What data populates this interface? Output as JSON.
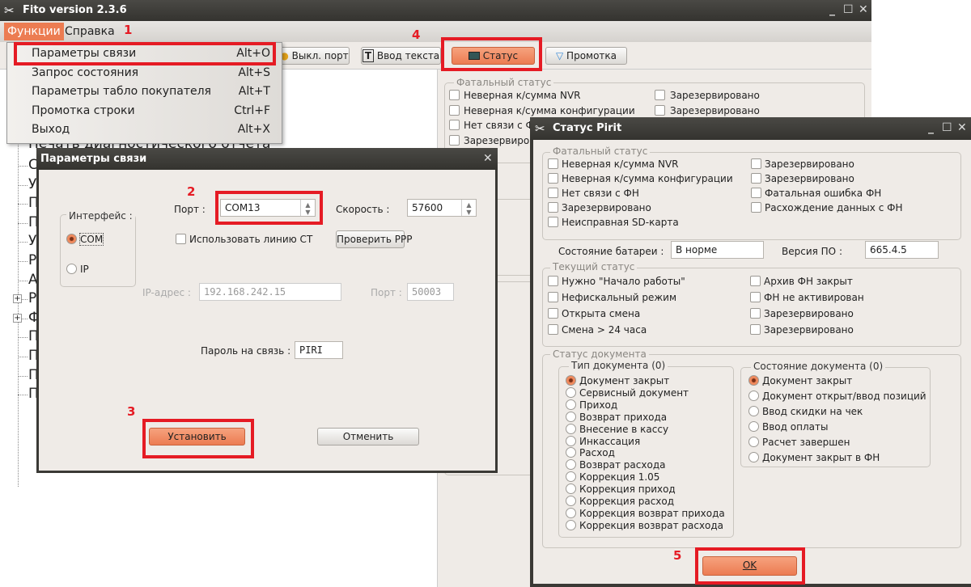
{
  "main_window": {
    "title": "Fito version 2.3.6",
    "menu": [
      "Функции",
      "Справка"
    ],
    "toolbar": {
      "port_off": "Выкл. порт",
      "text_input": "Ввод текста",
      "status": "Статус",
      "scroll": "Промотка"
    },
    "tree": {
      "first_item": "Печать диагностического отчета",
      "partial_items": [
        "С",
        "У",
        "П",
        "П",
        "У",
        "Р",
        "А",
        "Р",
        "Ф",
        "П",
        "П",
        "П",
        "П"
      ],
      "expandable": [
        7,
        8
      ]
    }
  },
  "functions_menu": [
    {
      "label": "Параметры связи",
      "shortcut": "Alt+O"
    },
    {
      "label": "Запрос состояния",
      "shortcut": "Alt+S"
    },
    {
      "label": "Параметры табло покупателя",
      "shortcut": "Alt+T"
    },
    {
      "label": "Промотка строки",
      "shortcut": "Ctrl+F"
    },
    {
      "label": "Выход",
      "shortcut": "Alt+X"
    }
  ],
  "annotations": [
    "1",
    "2",
    "3",
    "4",
    "5"
  ],
  "connection_dialog": {
    "title": "Параметры связи",
    "interface_label": "Интерфейс :",
    "interface_options": [
      "COM",
      "IP"
    ],
    "interface_selected": "COM",
    "port_label": "Порт :",
    "port_value": "COM13",
    "speed_label": "Скорость :",
    "speed_value": "57600",
    "use_ct_label": "Использовать линию CT",
    "use_ct_checked": false,
    "check_ppp": "Проверить PPP",
    "ip_label": "IP-адрес :",
    "ip_value": "192.168.242.15",
    "ip_port_label": "Порт :",
    "ip_port_value": "50003",
    "password_label": "Пароль на связь :",
    "password_value": "PIRI",
    "apply": "Установить",
    "cancel": "Отменить"
  },
  "status_dialog": {
    "title": "Статус Pirit",
    "fatal_title": "Фатальный статус",
    "fatal_left": [
      "Неверная к/сумма NVR",
      "Неверная к/сумма конфигурации",
      "Нет связи с ФН",
      "Зарезервировано",
      "Неисправная SD-карта"
    ],
    "fatal_right": [
      "Зарезервировано",
      "Зарезервировано",
      "Фатальная ошибка ФН",
      "Расхождение данных с ФН"
    ],
    "battery_label": "Состояние батареи :",
    "battery_value": "В норме",
    "version_label": "Версия ПО :",
    "version_value": "665.4.5",
    "current_title": "Текущий статус",
    "current_left": [
      "Нужно \"Начало работы\"",
      "Нефискальный режим",
      "Открыта смена",
      "Смена > 24 часа"
    ],
    "current_right": [
      "Архив ФН закрыт",
      "ФН не активирован",
      "Зарезервировано",
      "Зарезервировано"
    ],
    "doc_title": "Статус документа",
    "doc_type_title": "Тип документа (0)",
    "doc_types": [
      "Документ закрыт",
      "Сервисный документ",
      "Приход",
      "Возврат прихода",
      "Внесение в кассу",
      "Инкассация",
      "Расход",
      "Возврат расхода",
      "Коррекция 1.05",
      "Коррекция приход",
      "Коррекция расход",
      "Коррекция возврат прихода",
      "Коррекция возврат расхода"
    ],
    "doc_type_selected": 0,
    "doc_state_title": "Состояние документа (0)",
    "doc_states": [
      "Документ закрыт",
      "Документ открыт/ввод позиций",
      "Ввод скидки на чек",
      "Ввод оплаты",
      "Расчет завершен",
      "Документ закрыт в ФН"
    ],
    "doc_state_selected": 0,
    "ok": "OK"
  },
  "colors": {
    "accent": "#f08a5d",
    "highlight_box": "#e51b24",
    "titlebar": "#3a3935",
    "dialog_bg": "#efebe7"
  }
}
